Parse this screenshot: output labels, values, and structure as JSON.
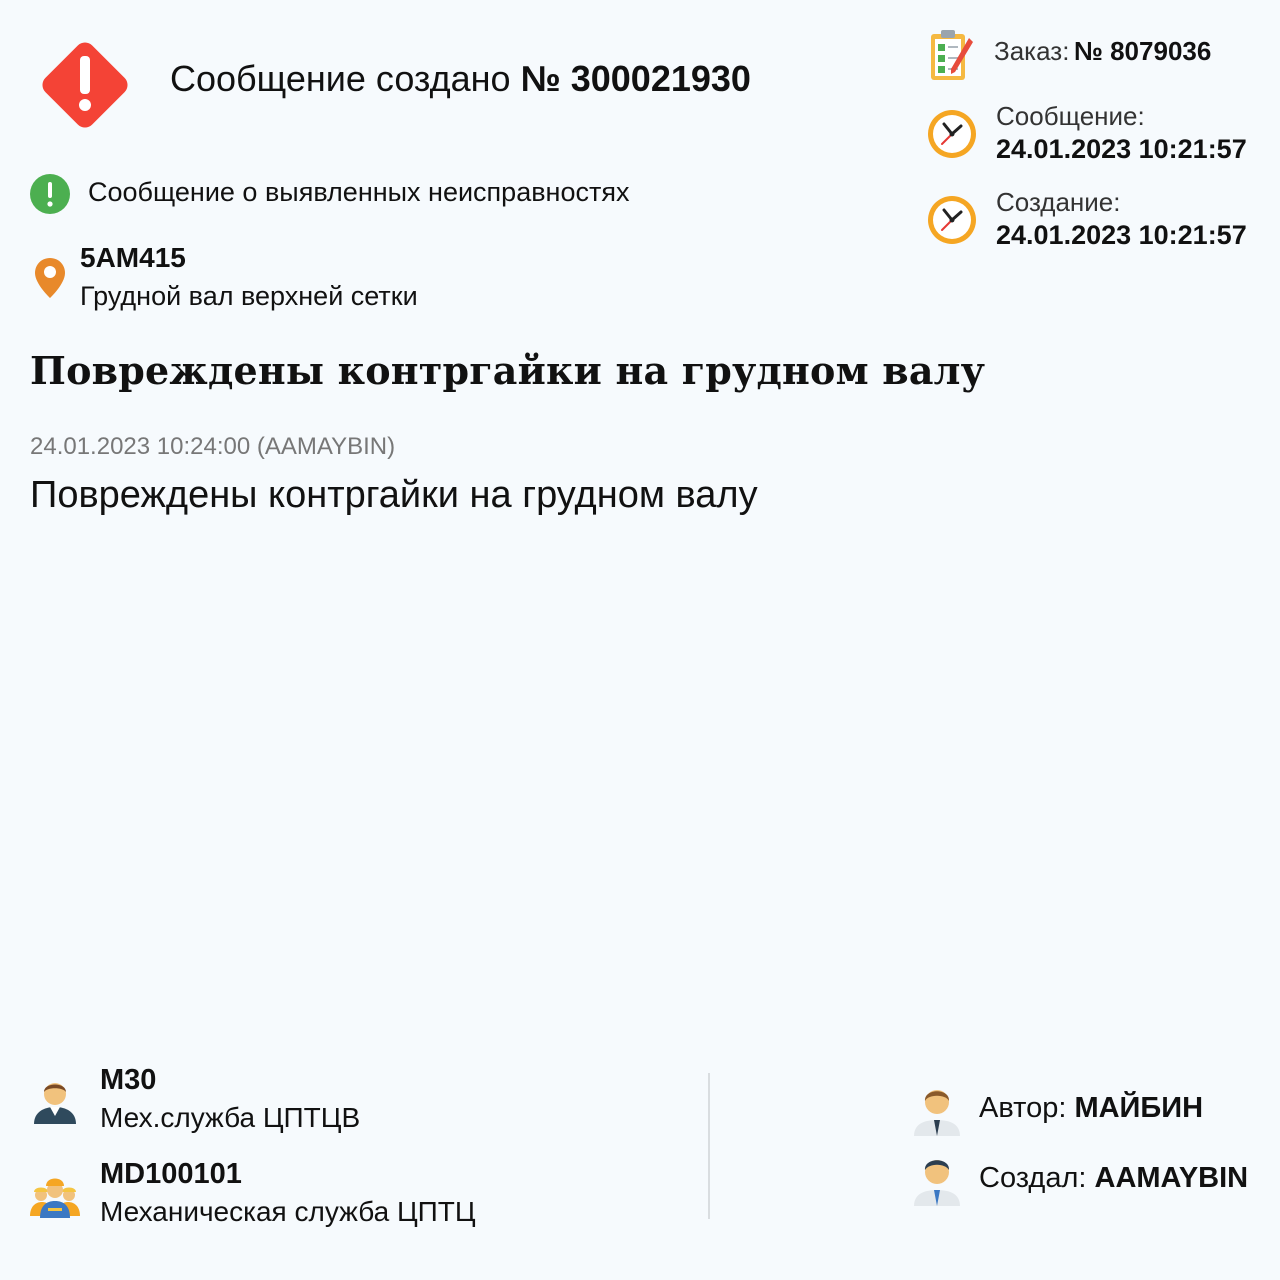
{
  "header": {
    "prefix": "Сообщение создано",
    "number": "№ 300021930"
  },
  "message_type": "Сообщение о выявленных неисправностях",
  "location": {
    "code": "5AM415",
    "name": "Грудной вал верхней сетки"
  },
  "title": "Повреждены контргайки на грудном валу",
  "note": {
    "meta": "24.01.2023 10:24:00 (AAMAYBIN)",
    "text": "Повреждены контргайки на грудном валу"
  },
  "right_panel": {
    "order_label": "Заказ:",
    "order_value": "№ 8079036",
    "message_label": "Сообщение:",
    "message_datetime": "24.01.2023 10:21:57",
    "created_label": "Создание:",
    "created_datetime": "24.01.2023 10:21:57"
  },
  "bottom": {
    "workcenter_code": "M30",
    "workcenter_name": "Мех.служба ЦПТЦВ",
    "planner_code": "MD100101",
    "planner_name": "Механическая служба ЦПТЦ",
    "author_label": "Автор:",
    "author_value": "МАЙБИН",
    "creator_label": "Создал:",
    "creator_value": "AAMAYBIN"
  },
  "colors": {
    "alert_red": "#f44336",
    "info_green": "#4caf50",
    "pin_orange": "#e8892b",
    "clock_orange": "#f5a623"
  }
}
